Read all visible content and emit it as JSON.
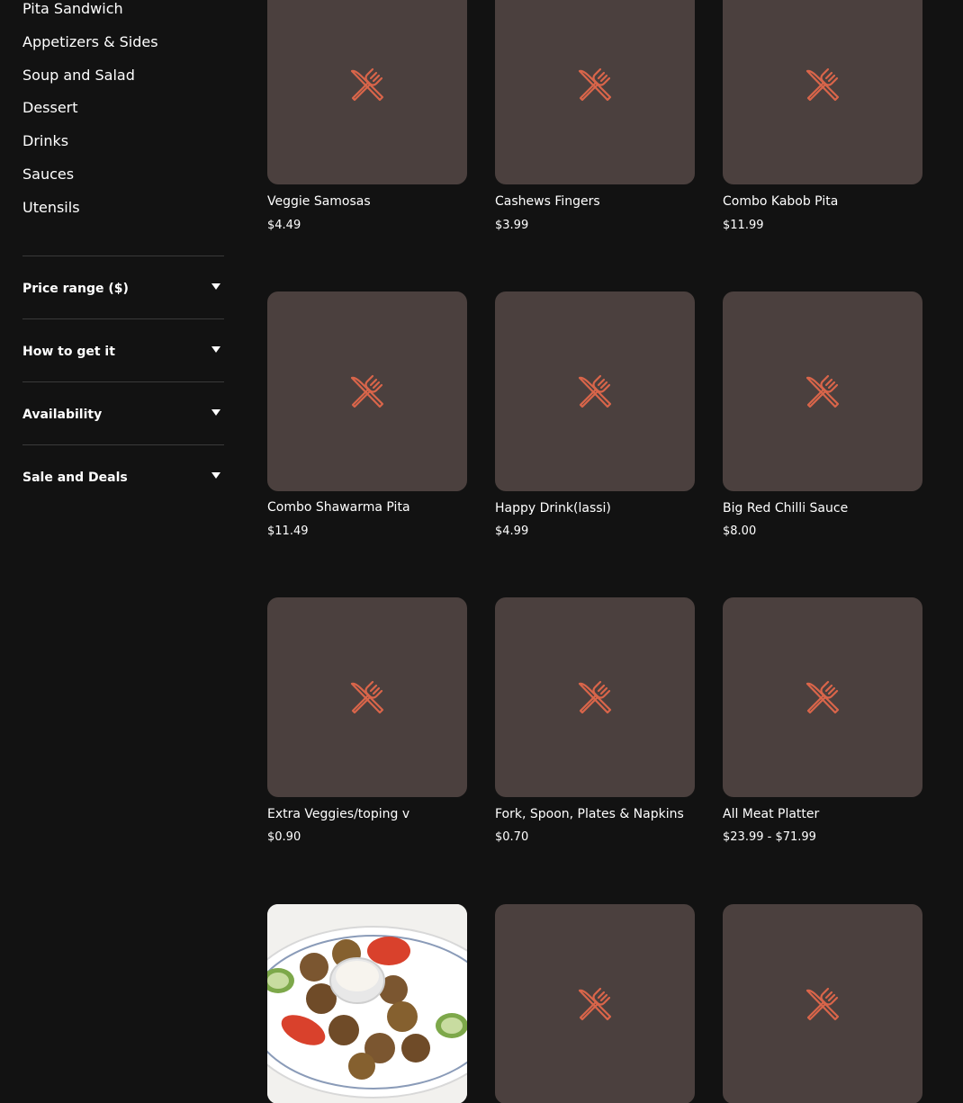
{
  "sidebar": {
    "categories": [
      "Pita Sandwich",
      "Appetizers & Sides",
      "Soup and Salad",
      "Dessert",
      "Drinks",
      "Sauces",
      "Utensils"
    ],
    "filters": [
      "Price range ($)",
      "How to get it",
      "Availability",
      "Sale and Deals"
    ]
  },
  "products": [
    {
      "name": "Veggie Samosas",
      "price": "$4.49",
      "image": "utensils-icon"
    },
    {
      "name": "Cashews Fingers",
      "price": "$3.99",
      "image": "utensils-icon"
    },
    {
      "name": "Combo Kabob Pita",
      "price": "$11.99",
      "image": "utensils-icon"
    },
    {
      "name": "Combo Shawarma Pita",
      "price": "$11.49",
      "image": "utensils-icon"
    },
    {
      "name": "Happy Drink(lassi)",
      "price": "$4.99",
      "image": "utensils-icon"
    },
    {
      "name": "Big Red Chilli Sauce",
      "price": "$8.00",
      "image": "utensils-icon"
    },
    {
      "name": "Extra Veggies/toping v",
      "price": "$0.90",
      "image": "utensils-icon"
    },
    {
      "name": "Fork, Spoon, Plates & Napkins",
      "price": "$0.70",
      "image": "utensils-icon"
    },
    {
      "name": "All Meat Platter",
      "price": "$23.99 - $71.99",
      "image": "utensils-icon"
    },
    {
      "name": "",
      "price": "",
      "image": "falafel-plate-photo"
    },
    {
      "name": "",
      "price": "",
      "image": "utensils-icon"
    },
    {
      "name": "",
      "price": "",
      "image": "utensils-icon"
    }
  ],
  "colors": {
    "background": "#121212",
    "placeholder": "#4b403e",
    "icon": "#d9654a"
  }
}
